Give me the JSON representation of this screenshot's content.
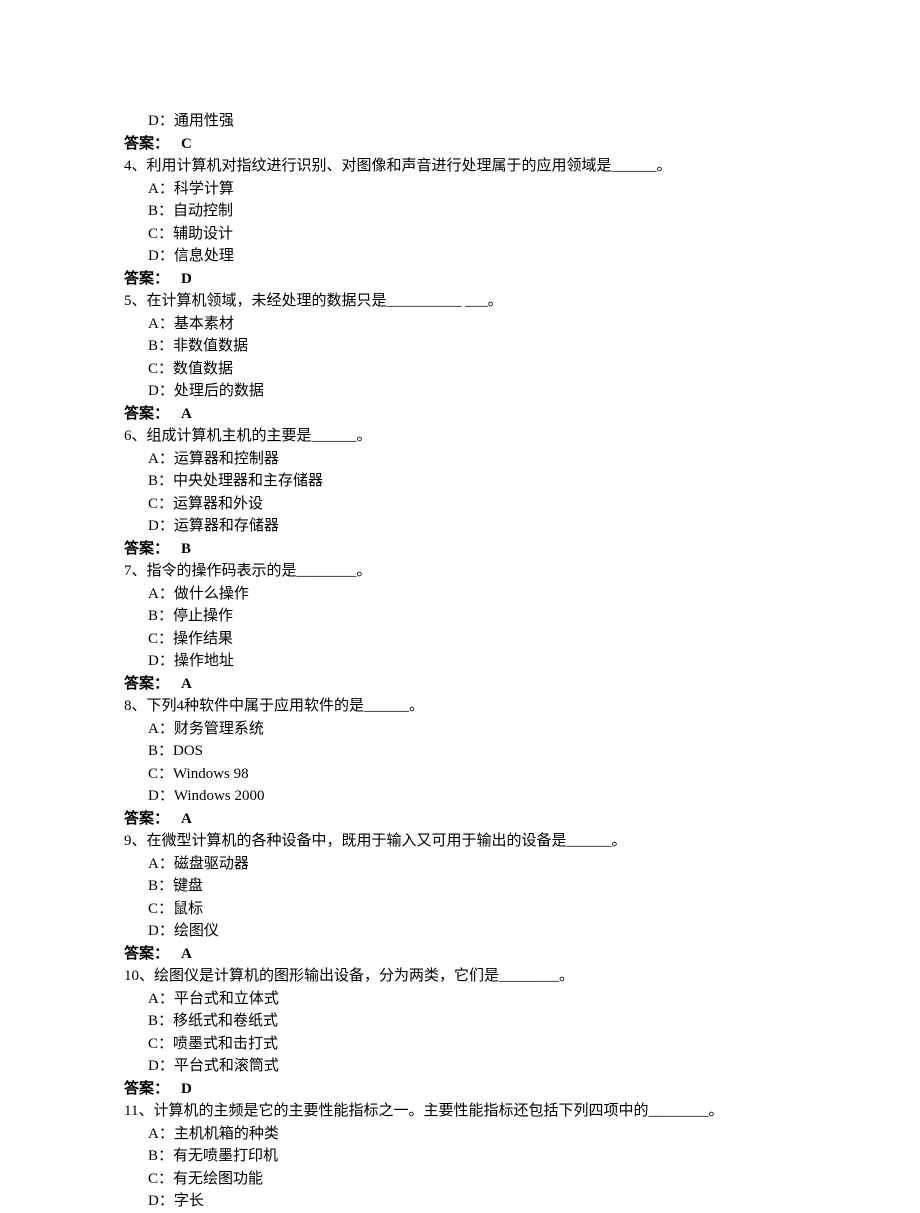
{
  "items": [
    {
      "type": "option",
      "text": "D：通用性强"
    },
    {
      "type": "answer",
      "label": "答案：",
      "value": "C"
    },
    {
      "type": "question",
      "text": "4、利用计算机对指纹进行识别、对图像和声音进行处理属于的应用领域是______。"
    },
    {
      "type": "option",
      "text": "A：科学计算"
    },
    {
      "type": "option",
      "text": "B：自动控制"
    },
    {
      "type": "option",
      "text": "C：辅助设计"
    },
    {
      "type": "option",
      "text": "D：信息处理"
    },
    {
      "type": "answer",
      "label": "答案：",
      "value": "D"
    },
    {
      "type": "question",
      "text": "5、在计算机领域，未经处理的数据只是__________ ___。"
    },
    {
      "type": "option",
      "text": "A：基本素材"
    },
    {
      "type": "option",
      "text": "B：非数值数据"
    },
    {
      "type": "option",
      "text": "C：数值数据"
    },
    {
      "type": "option",
      "text": "D：处理后的数据"
    },
    {
      "type": "answer",
      "label": "答案：",
      "value": "A"
    },
    {
      "type": "question",
      "text": "6、组成计算机主机的主要是______。"
    },
    {
      "type": "option",
      "text": "A：运算器和控制器"
    },
    {
      "type": "option",
      "text": "B：中央处理器和主存储器"
    },
    {
      "type": "option",
      "text": "C：运算器和外设"
    },
    {
      "type": "option",
      "text": "D：运算器和存储器"
    },
    {
      "type": "answer",
      "label": "答案：",
      "value": "B"
    },
    {
      "type": "question",
      "text": "7、指令的操作码表示的是________。"
    },
    {
      "type": "option",
      "text": "A：做什么操作"
    },
    {
      "type": "option",
      "text": "B：停止操作"
    },
    {
      "type": "option",
      "text": "C：操作结果"
    },
    {
      "type": "option",
      "text": "D：操作地址"
    },
    {
      "type": "answer",
      "label": "答案：",
      "value": "A"
    },
    {
      "type": "question",
      "text": "8、下列4种软件中属于应用软件的是______。"
    },
    {
      "type": "option",
      "text": "A：财务管理系统"
    },
    {
      "type": "option",
      "text": "B：DOS"
    },
    {
      "type": "option",
      "text": "C：Windows 98"
    },
    {
      "type": "option",
      "text": "D：Windows 2000"
    },
    {
      "type": "answer",
      "label": "答案：",
      "value": "A"
    },
    {
      "type": "question",
      "text": "9、在微型计算机的各种设备中，既用于输入又可用于输出的设备是______。"
    },
    {
      "type": "option",
      "text": "A：磁盘驱动器"
    },
    {
      "type": "option",
      "text": "B：键盘"
    },
    {
      "type": "option",
      "text": "C：鼠标"
    },
    {
      "type": "option",
      "text": "D：绘图仪"
    },
    {
      "type": "answer",
      "label": "答案：",
      "value": "A"
    },
    {
      "type": "question",
      "text": "10、绘图仪是计算机的图形输出设备，分为两类，它们是________。"
    },
    {
      "type": "option",
      "text": "A：平台式和立体式"
    },
    {
      "type": "option",
      "text": "B：移纸式和卷纸式"
    },
    {
      "type": "option",
      "text": "C：喷墨式和击打式"
    },
    {
      "type": "option",
      "text": "D：平台式和滚筒式"
    },
    {
      "type": "answer",
      "label": "答案：",
      "value": "D"
    },
    {
      "type": "question",
      "text": "11、计算机的主频是它的主要性能指标之一。主要性能指标还包括下列四项中的________。"
    },
    {
      "type": "option",
      "text": "A：主机机箱的种类"
    },
    {
      "type": "option",
      "text": "B：有无喷墨打印机"
    },
    {
      "type": "option",
      "text": "C：有无绘图功能"
    },
    {
      "type": "option",
      "text": "D：字长"
    }
  ]
}
